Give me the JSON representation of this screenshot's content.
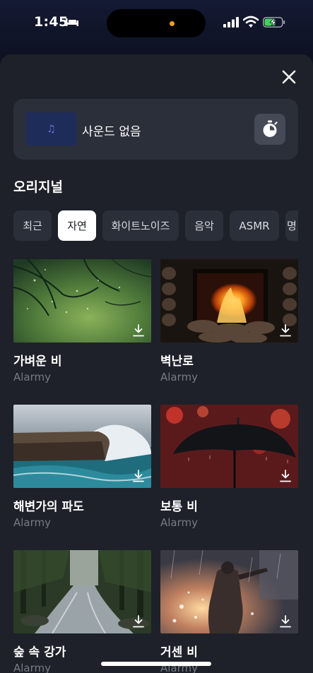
{
  "status_bar": {
    "time": "1:45",
    "icons": [
      "bed-icon",
      "cellular-signal-icon",
      "wifi-icon",
      "battery-charging-icon"
    ]
  },
  "now_playing": {
    "label": "사운드 없음",
    "thumb_icon": "music-note-icon"
  },
  "section": {
    "title": "오리지널"
  },
  "categories": [
    {
      "label": "최근",
      "active": false
    },
    {
      "label": "자연",
      "active": true
    },
    {
      "label": "화이트노이즈",
      "active": false
    },
    {
      "label": "음악",
      "active": false
    },
    {
      "label": "ASMR",
      "active": false
    },
    {
      "label": "명",
      "active": false
    }
  ],
  "sounds": [
    {
      "title": "가벼운 비",
      "subtitle": "Alarmy",
      "icon": "download-icon"
    },
    {
      "title": "벽난로",
      "subtitle": "Alarmy",
      "icon": "download-icon"
    },
    {
      "title": "해변가의 파도",
      "subtitle": "Alarmy",
      "icon": "download-icon"
    },
    {
      "title": "보통 비",
      "subtitle": "Alarmy",
      "icon": "download-icon"
    },
    {
      "title": "숲 속 강가",
      "subtitle": "Alarmy",
      "icon": "download-icon"
    },
    {
      "title": "거센 비",
      "subtitle": "Alarmy",
      "icon": "download-icon"
    }
  ],
  "colors": {
    "sheet": "#1e2129",
    "card": "#2b2f3a",
    "chip_active": "#ffffff",
    "subtitle": "#767b86",
    "island_dot": "#f0a020"
  }
}
